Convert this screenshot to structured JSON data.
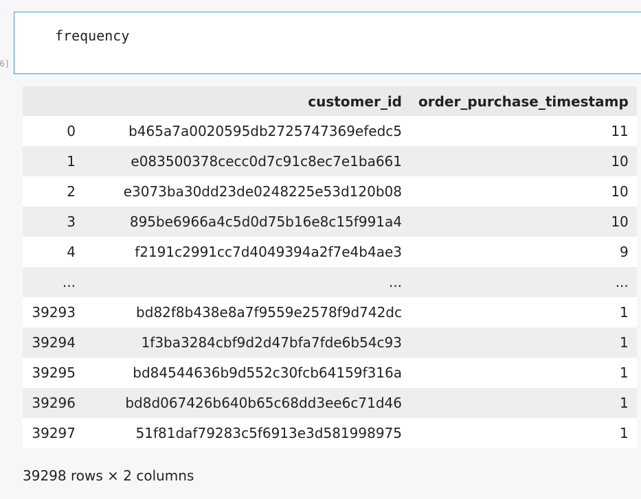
{
  "cell": {
    "prompt": "6]",
    "code": "frequency"
  },
  "dataframe": {
    "columns": [
      "",
      "customer_id",
      "order_purchase_timestamp"
    ],
    "rows": [
      {
        "index": "0",
        "customer_id": "b465a7a0020595db2725747369efedc5",
        "order_purchase_timestamp": "11"
      },
      {
        "index": "1",
        "customer_id": "e083500378cecc0d7c91c8ec7e1ba661",
        "order_purchase_timestamp": "10"
      },
      {
        "index": "2",
        "customer_id": "e3073ba30dd23de0248225e53d120b08",
        "order_purchase_timestamp": "10"
      },
      {
        "index": "3",
        "customer_id": "895be6966a4c5d0d75b16e8c15f991a4",
        "order_purchase_timestamp": "10"
      },
      {
        "index": "4",
        "customer_id": "f2191c2991cc7d4049394a2f7e4b4ae3",
        "order_purchase_timestamp": "9"
      },
      {
        "index": "...",
        "customer_id": "...",
        "order_purchase_timestamp": "..."
      },
      {
        "index": "39293",
        "customer_id": "bd82f8b438e8a7f9559e2578f9d742dc",
        "order_purchase_timestamp": "1"
      },
      {
        "index": "39294",
        "customer_id": "1f3ba3284cbf9d2d47bfa7fde6b54c93",
        "order_purchase_timestamp": "1"
      },
      {
        "index": "39295",
        "customer_id": "bd84544636b9d552c30fcb64159f316a",
        "order_purchase_timestamp": "1"
      },
      {
        "index": "39296",
        "customer_id": "bd8d067426b640b65c68dd3ee6c71d46",
        "order_purchase_timestamp": "1"
      },
      {
        "index": "39297",
        "customer_id": "51f81daf79283c5f6913e3d581998975",
        "order_purchase_timestamp": "1"
      }
    ],
    "shape_note": "39298 rows × 2 columns"
  }
}
